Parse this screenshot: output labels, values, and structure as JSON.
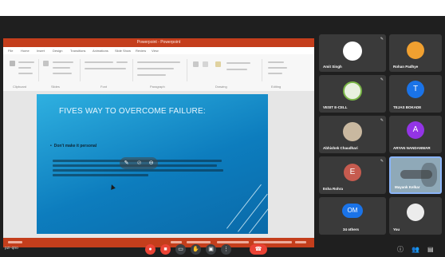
{
  "meeting": {
    "code": "pzr-qno",
    "others_count": "34 others"
  },
  "presentation": {
    "window_title": "Powerpoint - Powerpoint",
    "tabs": [
      "File",
      "Home",
      "Insert",
      "Design",
      "Transitions",
      "Animations",
      "Slide Show",
      "Review",
      "View"
    ],
    "ribbon_groups": [
      "Clipboard",
      "Slides",
      "Font",
      "Paragraph",
      "Drawing",
      "Editing"
    ],
    "slide": {
      "title": "FIVES WAY TO OVERCOME FAILURE:",
      "bullet": "Don't make it personal",
      "body_lines": 4
    }
  },
  "participants": [
    {
      "name": "Amit Singh",
      "initial": "",
      "avatar_color": "#ffffff"
    },
    {
      "name": "Rohan Padhye",
      "initial": "",
      "avatar_color": "#f0a030"
    },
    {
      "name": "VESIT E-CELL",
      "initial": "",
      "avatar_color": "#e8f0e0"
    },
    {
      "name": "TEJAS BOKADE",
      "initial": "T",
      "avatar_color": "#1a73e8"
    },
    {
      "name": "Abhishek Chaudhari",
      "initial": "",
      "avatar_color": "#c9b8a0"
    },
    {
      "name": "ARYAN NANDANWAR",
      "initial": "A",
      "avatar_color": "#9334e6"
    },
    {
      "name": "Esha Rohra",
      "initial": "E",
      "avatar_color": "#c65b4f"
    },
    {
      "name": "Mayank Kelkar",
      "initial": "",
      "avatar_color": "#9fb7c4"
    },
    {
      "name": "34 others",
      "initial": "OM",
      "avatar_color": "#1a73e8"
    },
    {
      "name": "You",
      "initial": "",
      "avatar_color": "#ececec"
    }
  ],
  "toolbar": {
    "mic_icon": "mic-off-icon",
    "camera_icon": "camera-off-icon",
    "captions_icon": "captions-icon",
    "hand_icon": "raise-hand-icon",
    "present_icon": "present-icon",
    "more_icon": "more-options-icon",
    "leave_icon": "leave-call-icon"
  },
  "colors": {
    "call_background": "#1f1f1f",
    "powerpoint_red": "#c43e1c",
    "leave_red": "#ea4335",
    "slide_blue": "#0d7dbe"
  }
}
